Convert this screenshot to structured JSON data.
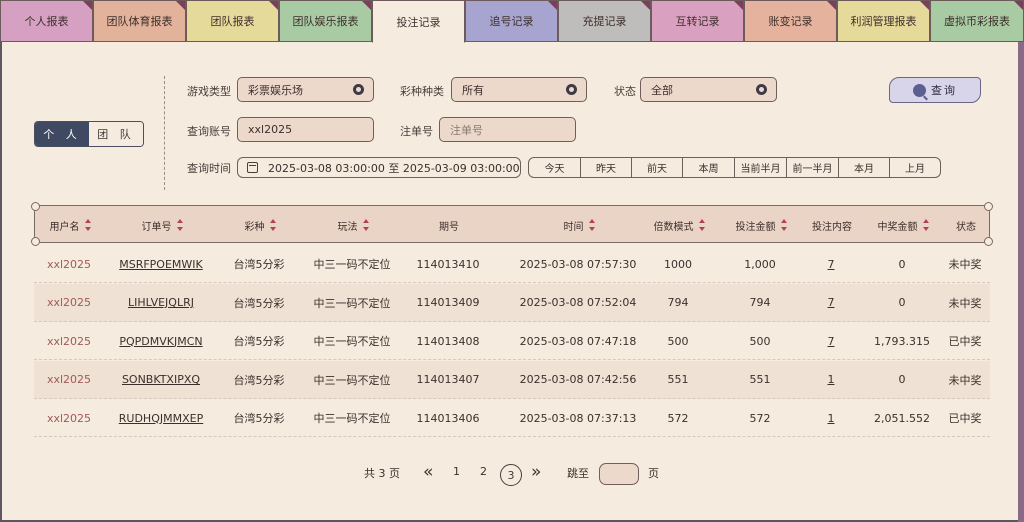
{
  "tabs": [
    {
      "label": "个人报表",
      "color": "#d5a0c2"
    },
    {
      "label": "团队体育报表",
      "color": "#e2b39a"
    },
    {
      "label": "团队报表",
      "color": "#e6da9b"
    },
    {
      "label": "团队娱乐报表",
      "color": "#a9cba4"
    },
    {
      "label": "投注记录",
      "color": "#f5ebdf"
    },
    {
      "label": "追号记录",
      "color": "#a7a5cf"
    },
    {
      "label": "充提记录",
      "color": "#bfbcbc"
    },
    {
      "label": "互转记录",
      "color": "#d9a0bf"
    },
    {
      "label": "账变记录",
      "color": "#e5b39d"
    },
    {
      "label": "利润管理报表",
      "color": "#e6da9b"
    },
    {
      "label": "虚拟币彩报表",
      "color": "#a9cba4"
    }
  ],
  "scope": {
    "personal": "个 人",
    "team": "团 队"
  },
  "filters": {
    "game_type_label": "游戏类型",
    "game_type_value": "彩票娱乐场",
    "lottery_label": "彩种种类",
    "lottery_value": "所有",
    "status_label": "状态",
    "status_value": "全部",
    "account_label": "查询账号",
    "account_value": "xxl2025",
    "order_label": "注单号",
    "order_placeholder": "注单号",
    "time_label": "查询时间",
    "time_range": "2025-03-08 03:00:00 至 2025-03-09 03:00:00",
    "query_button": "查询",
    "quick_ranges": [
      "今天",
      "昨天",
      "前天",
      "本周",
      "当前半月",
      "前一半月",
      "本月",
      "上月"
    ]
  },
  "table": {
    "headers": [
      "用户名",
      "订单号",
      "彩种",
      "玩法",
      "期号",
      "时间",
      "倍数模式",
      "投注金额",
      "投注内容",
      "中奖金额",
      "状态"
    ],
    "rows": [
      [
        "xxl2025",
        "MSRFPOEMWIK",
        "台湾5分彩",
        "中三一码不定位",
        "114013410",
        "2025-03-08 07:57:30",
        "1000",
        "1,000",
        "7",
        "0",
        "未中奖"
      ],
      [
        "xxl2025",
        "LIHLVEJQLRJ",
        "台湾5分彩",
        "中三一码不定位",
        "114013409",
        "2025-03-08 07:52:04",
        "794",
        "794",
        "7",
        "0",
        "未中奖"
      ],
      [
        "xxl2025",
        "PQPDMVKJMCN",
        "台湾5分彩",
        "中三一码不定位",
        "114013408",
        "2025-03-08 07:47:18",
        "500",
        "500",
        "7",
        "1,793.315",
        "已中奖"
      ],
      [
        "xxl2025",
        "SONBKTXIPXQ",
        "台湾5分彩",
        "中三一码不定位",
        "114013407",
        "2025-03-08 07:42:56",
        "551",
        "551",
        "1",
        "0",
        "未中奖"
      ],
      [
        "xxl2025",
        "RUDHQJMMXEP",
        "台湾5分彩",
        "中三一码不定位",
        "114013406",
        "2025-03-08 07:37:13",
        "572",
        "572",
        "1",
        "2,051.552",
        "已中奖"
      ]
    ]
  },
  "pagination": {
    "total": "共 3 页",
    "first": "«",
    "pages": [
      "1",
      "2",
      "3"
    ],
    "current": "3",
    "last": "»",
    "jump_label": "跳至",
    "page_suffix": "页"
  }
}
